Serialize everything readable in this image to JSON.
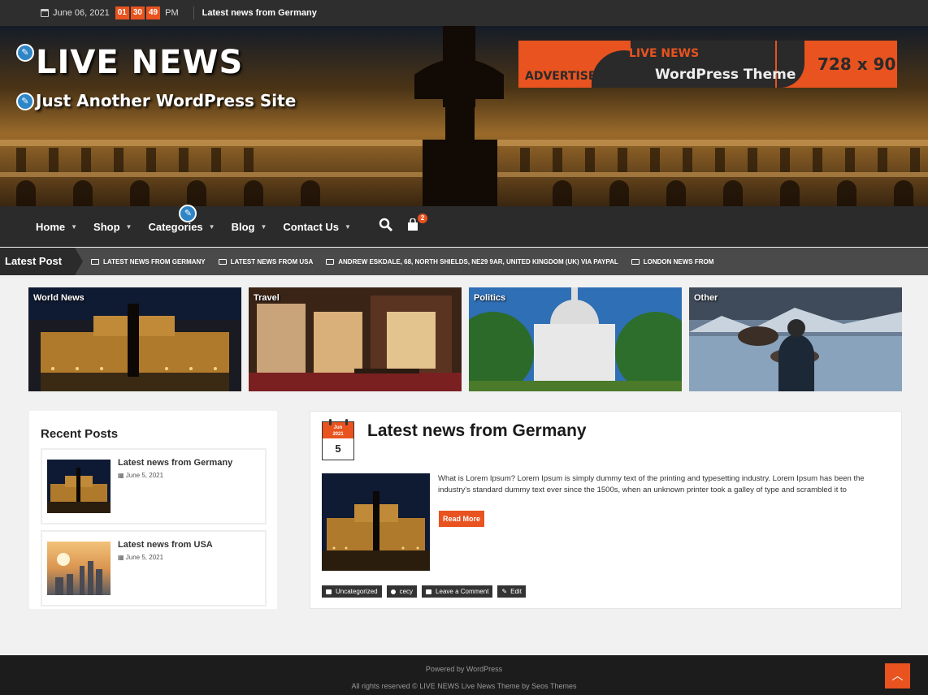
{
  "topbar": {
    "date": "June 06, 2021",
    "hours": "01",
    "minutes": "30",
    "seconds": "49",
    "ampm": "PM",
    "latest_title": "Latest news from Germany"
  },
  "header": {
    "site_title": "LIVE NEWS",
    "tagline": "Just Another WordPress Site",
    "ad": {
      "advertise": "ADVERTISE",
      "brand": "LIVE NEWS",
      "theme": "WordPress Theme",
      "size": "728 x 90"
    }
  },
  "nav": {
    "items": [
      {
        "label": "Home"
      },
      {
        "label": "Shop"
      },
      {
        "label": "Categories"
      },
      {
        "label": "Blog"
      },
      {
        "label": "Contact Us"
      }
    ],
    "cart_count": "2"
  },
  "ticker": {
    "label": "Latest Post",
    "items": [
      "LATEST NEWS FROM GERMANY",
      "LATEST NEWS FROM USA",
      "ANDREW ESKDALE, 68, NORTH SHIELDS, NE29 9AR, UNITED KINGDOM (UK) VIA PAYPAL",
      "LONDON NEWS FROM"
    ]
  },
  "categories": [
    {
      "label": "World News"
    },
    {
      "label": "Travel"
    },
    {
      "label": "Politics"
    },
    {
      "label": "Other"
    }
  ],
  "sidebar": {
    "title": "Recent Posts",
    "posts": [
      {
        "title": "Latest news from Germany",
        "date": "June 5, 2021"
      },
      {
        "title": "Latest news from USA",
        "date": "June 5, 2021"
      }
    ]
  },
  "article": {
    "date_month": "Jun",
    "date_year": "2021",
    "date_day": "5",
    "title": "Latest news from Germany",
    "excerpt": "What is Lorem Ipsum? Lorem Ipsum is simply dummy text of the printing and typesetting industry. Lorem Ipsum has been the industry's standard dummy text ever since the 1500s, when an unknown printer took a galley of type and scrambled it to",
    "read_more": "Read More",
    "meta": {
      "category": "Uncategorized",
      "author": "cecy",
      "comment": "Leave a Comment",
      "edit": "Edit"
    }
  },
  "footer": {
    "powered": "Powered by WordPress",
    "rights": "All rights reserved © LIVE NEWS Live News Theme by Seos Themes"
  },
  "colors": {
    "accent": "#e8531f",
    "dark": "#2b2b2b",
    "ticker": "#4a4a4a"
  }
}
